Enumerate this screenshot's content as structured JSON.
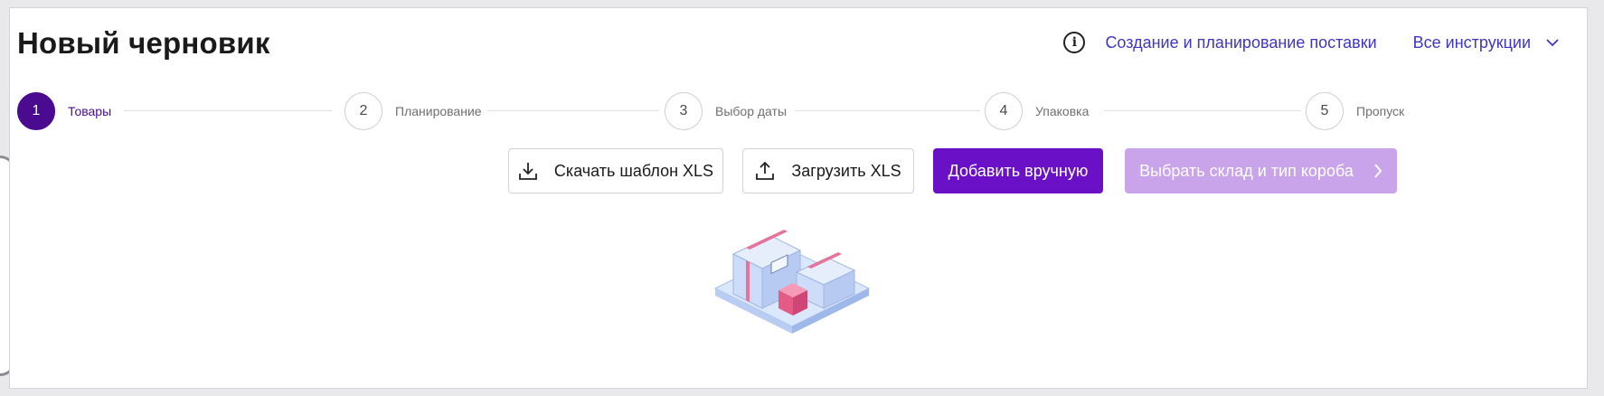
{
  "page": {
    "title": "Новый черновик"
  },
  "help": {
    "info_icon": "info-circle-icon",
    "guide_link": "Создание и планирование поставки",
    "all_instructions": "Все инструкции",
    "chevron_icon": "chevron-down-icon"
  },
  "stepper": {
    "active_step": 1,
    "steps": [
      {
        "number": "1",
        "label": "Товары"
      },
      {
        "number": "2",
        "label": "Планирование"
      },
      {
        "number": "3",
        "label": "Выбор даты"
      },
      {
        "number": "4",
        "label": "Упаковка"
      },
      {
        "number": "5",
        "label": "Пропуск"
      }
    ]
  },
  "actions": {
    "download_template": {
      "label": "Скачать шаблон XLS",
      "icon": "download-icon"
    },
    "upload_xls": {
      "label": "Загрузить XLS",
      "icon": "upload-icon"
    },
    "add_manually": {
      "label": "Добавить вручную"
    },
    "choose_warehouse": {
      "label": "Выбрать склад и тип короба",
      "icon": "chevron-right-icon",
      "disabled": true
    }
  },
  "empty_state": {
    "illustration": "boxes-on-pallet-illustration"
  },
  "colors": {
    "accent": "#6a10c6",
    "accent_dark": "#4a0b90",
    "accent_disabled": "#c9a4ea",
    "link": "#3e35c2"
  }
}
